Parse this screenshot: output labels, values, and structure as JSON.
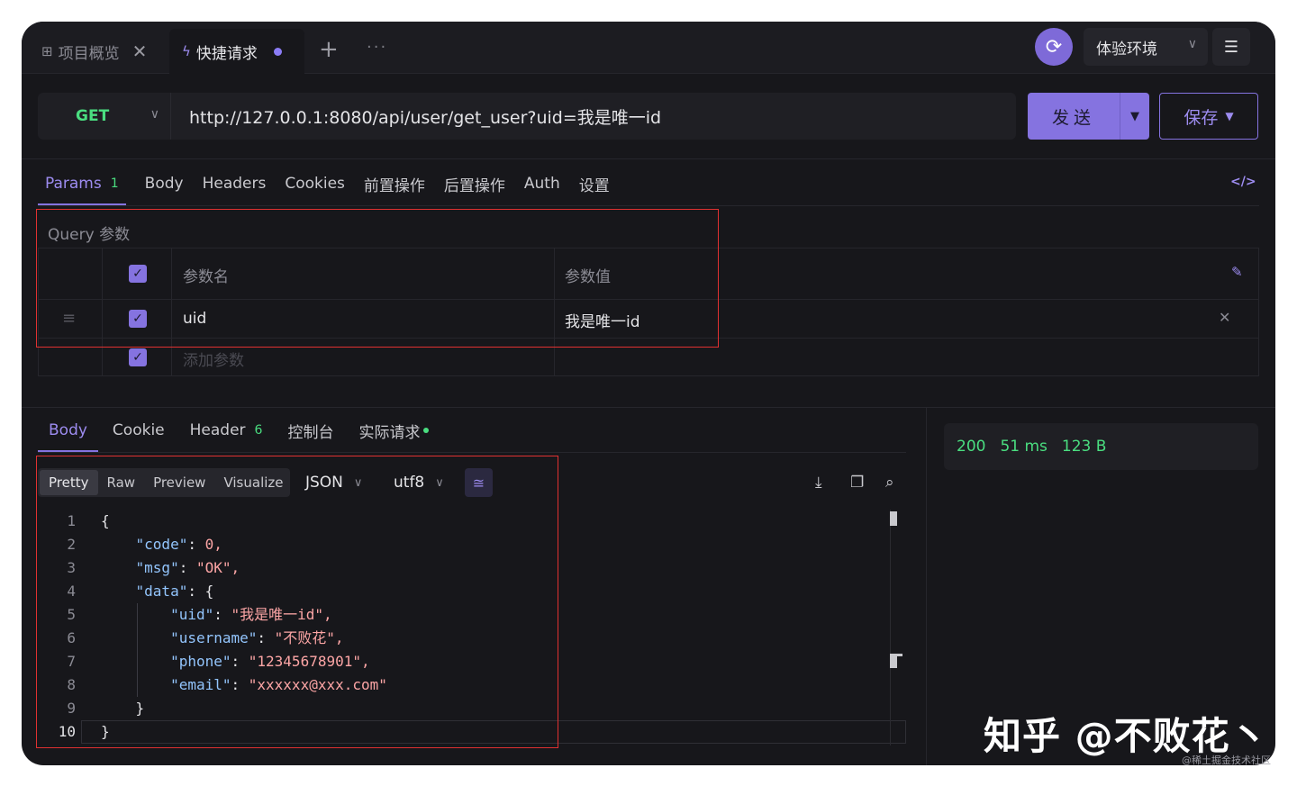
{
  "tabs": [
    {
      "icon": "grid-icon",
      "label": "项目概览"
    },
    {
      "icon": "lightning-icon",
      "label": "快捷请求"
    }
  ],
  "tabbar": {
    "more": "···"
  },
  "environment": {
    "label": "体验环境"
  },
  "request": {
    "method": "GET",
    "url": "http://127.0.0.1:8080/api/user/get_user?uid=我是唯一id",
    "send_label": "发送",
    "save_label": "保存"
  },
  "request_tabs": [
    {
      "label": "Params",
      "badge": "1",
      "active": true
    },
    {
      "label": "Body"
    },
    {
      "label": "Headers"
    },
    {
      "label": "Cookies"
    },
    {
      "label": "前置操作"
    },
    {
      "label": "后置操作"
    },
    {
      "label": "Auth"
    },
    {
      "label": "设置"
    }
  ],
  "query": {
    "section_label": "Query 参数",
    "col_name": "参数名",
    "col_value": "参数值",
    "rows": [
      {
        "name": "uid",
        "value": "我是唯一id"
      }
    ],
    "add_placeholder": "添加参数"
  },
  "response_tabs": [
    {
      "label": "Body",
      "active": true
    },
    {
      "label": "Cookie"
    },
    {
      "label": "Header",
      "badge": "6"
    },
    {
      "label": "控制台"
    },
    {
      "label": "实际请求",
      "dot": true
    }
  ],
  "format": {
    "modes": [
      "Pretty",
      "Raw",
      "Preview",
      "Visualize"
    ],
    "active_mode": "Pretty",
    "type": "JSON",
    "encoding": "utf8"
  },
  "code_lines": [
    "{",
    "    \"code\": 0,",
    "    \"msg\": \"OK\",",
    "    \"data\": {",
    "        \"uid\": \"我是唯一id\",",
    "        \"username\": \"不败花\",",
    "        \"phone\": \"12345678901\",",
    "        \"email\": \"xxxxxx@xxx.com\"",
    "    }",
    "}"
  ],
  "status": {
    "code": "200",
    "time": "51 ms",
    "size": "123 B"
  },
  "watermark": {
    "main": "知乎 @不败花丶",
    "sub": "@稀土掘金技术社区"
  }
}
